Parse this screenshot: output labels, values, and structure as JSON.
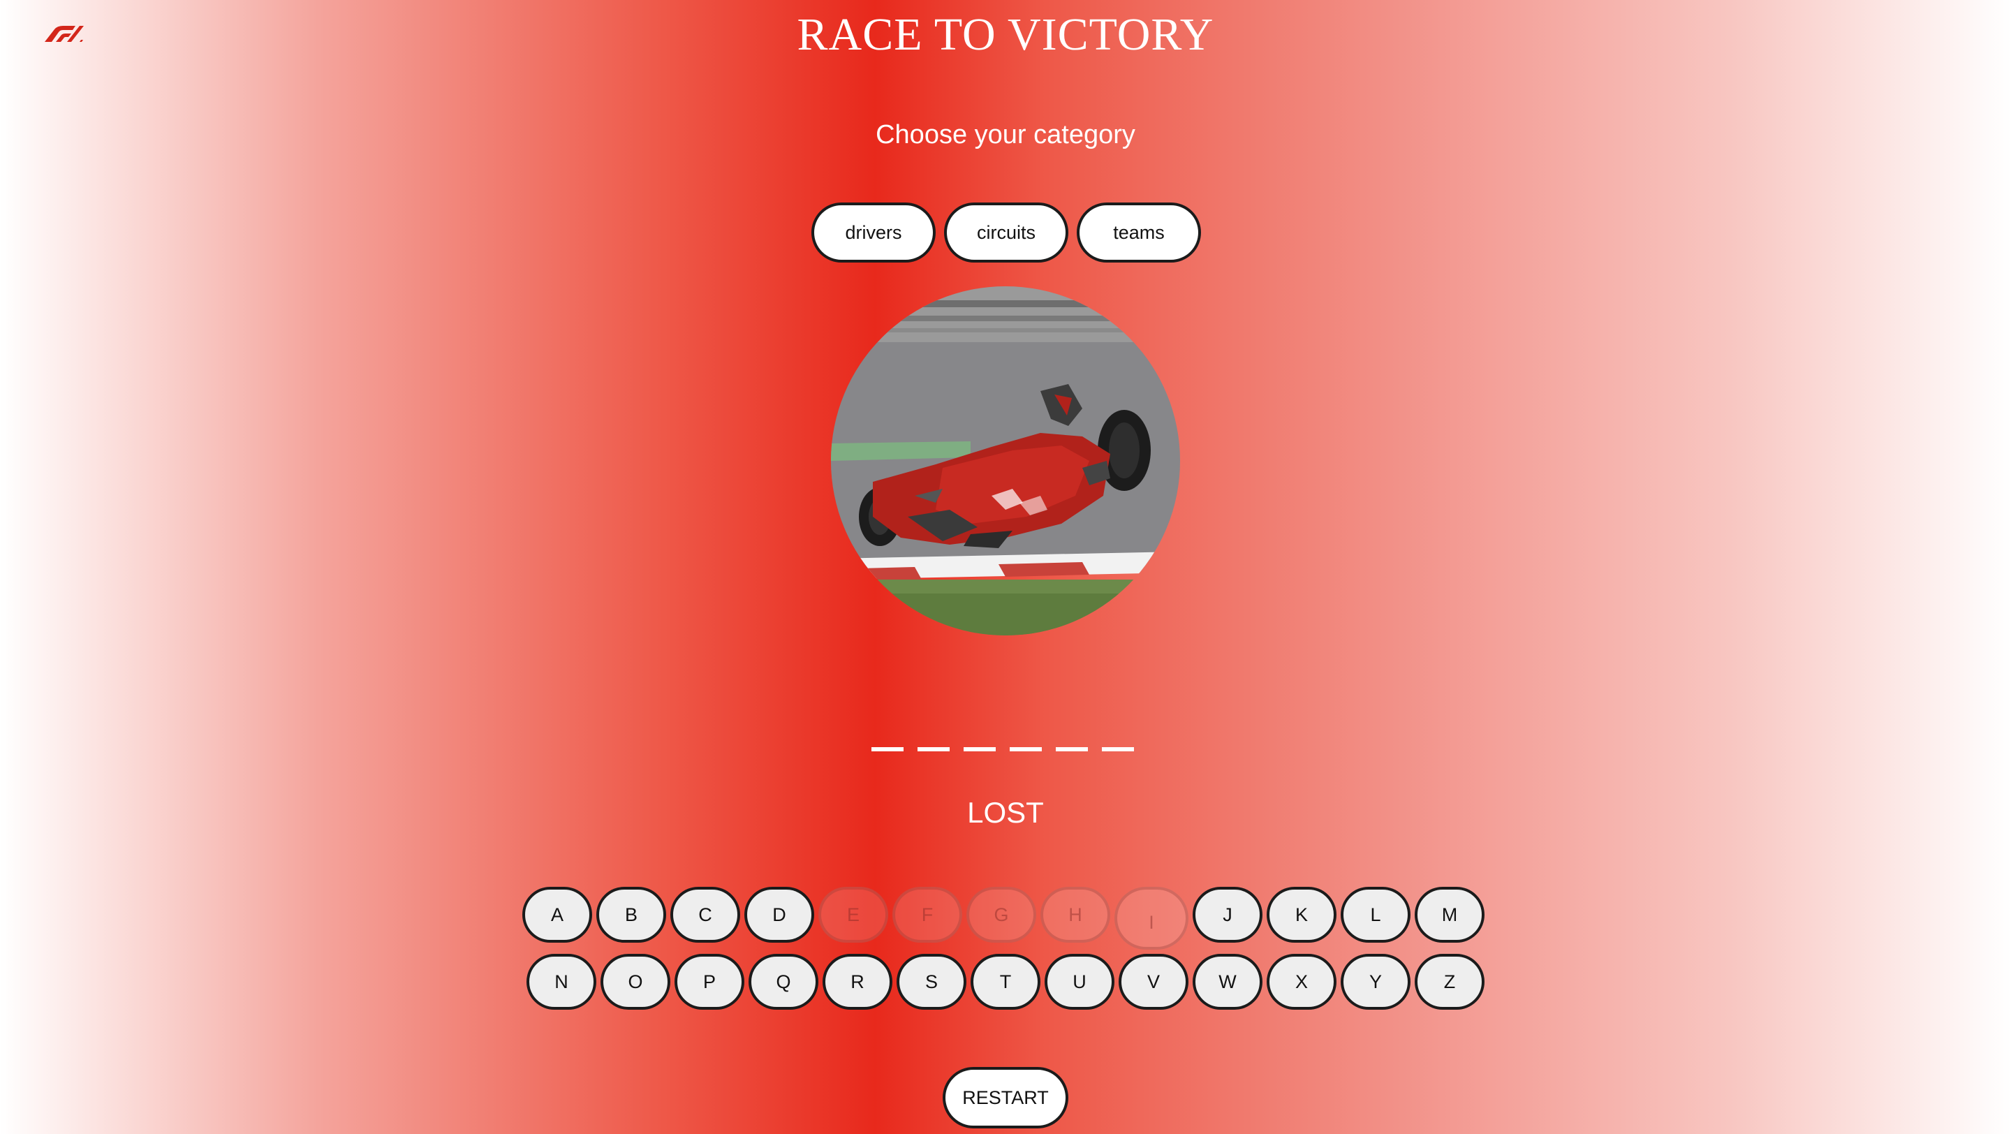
{
  "header": {
    "logo_icon": "f1-logo-icon",
    "title": "RACE TO VICTORY"
  },
  "categories": {
    "heading": "Choose your category",
    "options": [
      "drivers",
      "circuits",
      "teams"
    ]
  },
  "image": {
    "icon": "crashed-race-car-image"
  },
  "word": {
    "blank_count": 6
  },
  "status": "LOST",
  "keyboard": {
    "row1": [
      {
        "letter": "A",
        "used": false
      },
      {
        "letter": "B",
        "used": false
      },
      {
        "letter": "C",
        "used": false
      },
      {
        "letter": "D",
        "used": false
      },
      {
        "letter": "E",
        "used": true
      },
      {
        "letter": "F",
        "used": true
      },
      {
        "letter": "G",
        "used": true
      },
      {
        "letter": "H",
        "used": true
      },
      {
        "letter": "I",
        "used": true
      },
      {
        "letter": "J",
        "used": false
      },
      {
        "letter": "K",
        "used": false
      },
      {
        "letter": "L",
        "used": false
      },
      {
        "letter": "M",
        "used": false
      }
    ],
    "row2": [
      {
        "letter": "N",
        "used": false
      },
      {
        "letter": "O",
        "used": false
      },
      {
        "letter": "P",
        "used": false
      },
      {
        "letter": "Q",
        "used": false
      },
      {
        "letter": "R",
        "used": false
      },
      {
        "letter": "S",
        "used": false
      },
      {
        "letter": "T",
        "used": false
      },
      {
        "letter": "U",
        "used": false
      },
      {
        "letter": "V",
        "used": false
      },
      {
        "letter": "W",
        "used": false
      },
      {
        "letter": "X",
        "used": false
      },
      {
        "letter": "Y",
        "used": false
      },
      {
        "letter": "Z",
        "used": false
      }
    ]
  },
  "restart_label": "RESTART",
  "colors": {
    "accent_red": "#e8291c",
    "text_white": "#ffffff",
    "key_border": "#1b1b1b"
  }
}
